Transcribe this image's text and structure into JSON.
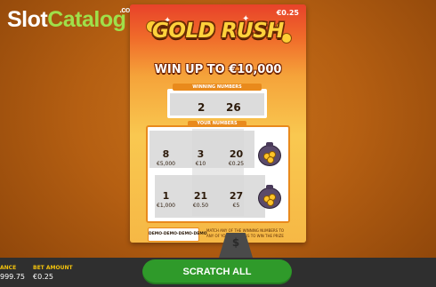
{
  "watermark": {
    "part1": "Slot",
    "part2": "Catalog",
    "suffix": ".com"
  },
  "card": {
    "price": "€0.25",
    "logo": "GOLD RUSH",
    "headline": "WIN UP TO €10,000",
    "winning_numbers_label": "WINNING NUMBERS",
    "winning_numbers": [
      "2",
      "26"
    ],
    "your_numbers_label": "YOUR NUMBERS",
    "cells": [
      {
        "number": "8",
        "prize": "€5,000"
      },
      {
        "number": "3",
        "prize": "€10"
      },
      {
        "number": "20",
        "prize": "€0.25"
      },
      {
        "number": "1",
        "prize": "€1,000"
      },
      {
        "number": "21",
        "prize": "€0.50"
      },
      {
        "number": "27",
        "prize": "€5"
      }
    ],
    "demo_label": "DEMO·DEMO·DEMO·DEMO",
    "rules_text": "MATCH ANY OF THE WINNING NUMBERS TO ANY OF YOUR NUMBERS TO WIN THE PRIZE",
    "dollar_symbol": "$"
  },
  "footer": {
    "balance_label": "ANCE",
    "balance_value": "999.75",
    "bet_label": "BET AMOUNT",
    "bet_value": "€0.25",
    "scratch_button": "SCRATCH ALL"
  },
  "colors": {
    "accent_green": "#2f9a2a",
    "label_yellow": "#f2c20d",
    "card_orange": "#e98a1c",
    "watermark_green": "#9fe04a"
  }
}
